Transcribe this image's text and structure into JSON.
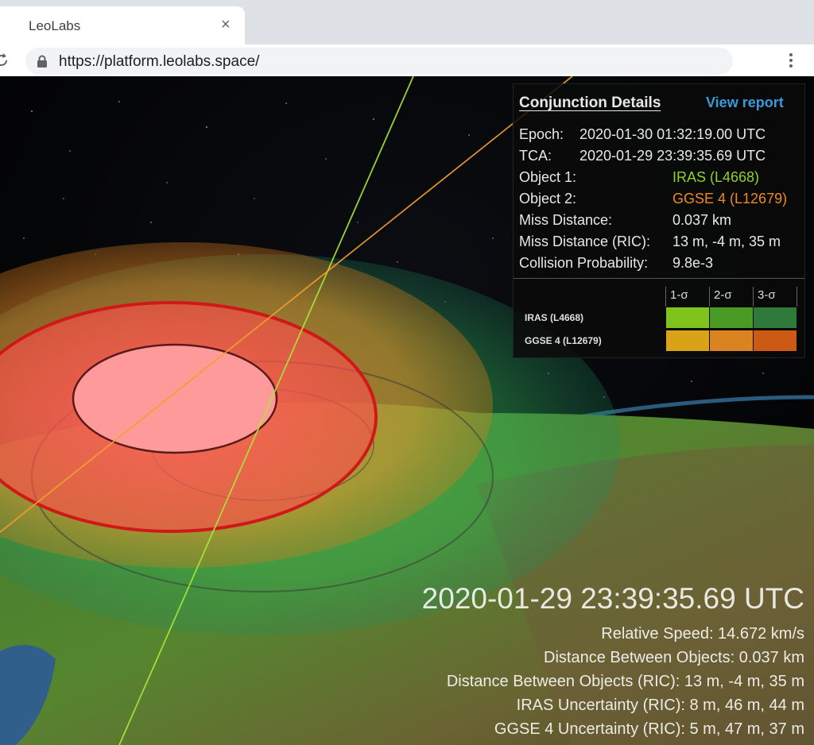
{
  "browser": {
    "tab_title": "LeoLabs",
    "tab_close": "×",
    "url": "https://platform.leolabs.space/"
  },
  "panel": {
    "title": "Conjunction Details",
    "view_report": "View report",
    "rows": [
      {
        "label": "Epoch:",
        "value": "2020-01-30 01:32:19.00 UTC"
      },
      {
        "label": "TCA:",
        "value": "2020-01-29 23:39:35.69 UTC"
      },
      {
        "label": "Object 1:",
        "value": "IRAS (L4668)"
      },
      {
        "label": "Object 2:",
        "value": "GGSE 4 (L12679)"
      },
      {
        "label": "Miss Distance:",
        "value": "0.037 km"
      },
      {
        "label": "Miss Distance (RIC):",
        "value": "13 m, -4 m, 35 m"
      },
      {
        "label": "Collision Probability:",
        "value": "9.8e-3"
      }
    ],
    "sigma_headers": [
      "1-σ",
      "2-σ",
      "3-σ"
    ],
    "uncertainty_rows": [
      {
        "name": "IRAS (L4668)",
        "colors": [
          "#7fc31c",
          "#4a9a26",
          "#2f7a3a"
        ]
      },
      {
        "name": "GGSE 4 (L12679)",
        "colors": [
          "#d9a318",
          "#d98420",
          "#cc5a14"
        ]
      }
    ],
    "colors": {
      "object1": "#8fd12a",
      "object2": "#f08a1e",
      "link": "#3a9ad9"
    }
  },
  "overlay": {
    "tca_time": "2020-01-29 23:39:35.69 UTC",
    "stats": [
      "Relative Speed: 14.672 km/s",
      "Distance Between Objects: 0.037 km",
      "Distance Between Objects (RIC): 13 m, -4 m, 35 m",
      "IRAS Uncertainty (RIC): 8 m, 46 m, 44 m",
      "GGSE 4 Uncertainty (RIC): 5 m, 47 m, 37 m"
    ]
  }
}
